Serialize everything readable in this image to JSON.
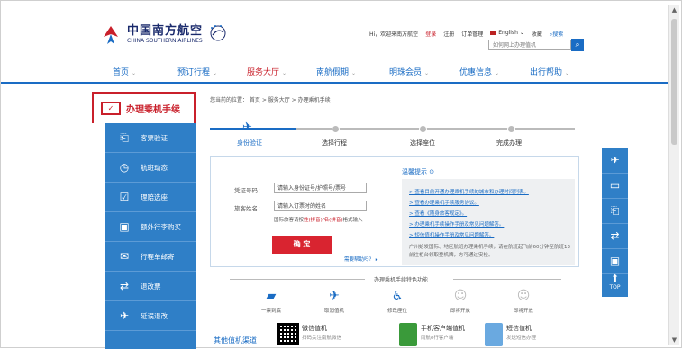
{
  "header": {
    "logo_cn": "中国南方航空",
    "logo_en": "CHINA SOUTHERN AIRLINES",
    "greeting": "Hi，欢迎来南方航空",
    "login": "登录",
    "register": "注册",
    "orders": "订单管理",
    "language": "English",
    "favorites": "收藏",
    "search_link": "搜索",
    "search_placeholder": "如何网上办理值机"
  },
  "nav": {
    "items": [
      {
        "label": "首页"
      },
      {
        "label": "预订行程"
      },
      {
        "label": "服务大厅"
      },
      {
        "label": "南航假期"
      },
      {
        "label": "明珠会员"
      },
      {
        "label": "优惠信息"
      },
      {
        "label": "出行帮助"
      }
    ],
    "active_index": 2
  },
  "sidebar": {
    "title": "办理乘机手续",
    "items": [
      {
        "label": "客票验证",
        "icon": "ticket-icon"
      },
      {
        "label": "航班动态",
        "icon": "clock-icon"
      },
      {
        "label": "理赔选座",
        "icon": "seat-icon"
      },
      {
        "label": "额外行李购买",
        "icon": "luggage-icon"
      },
      {
        "label": "行程单邮寄",
        "icon": "mail-icon"
      },
      {
        "label": "退改票",
        "icon": "refund-icon"
      },
      {
        "label": "延误退改",
        "icon": "delay-icon"
      }
    ]
  },
  "breadcrumb": "您当前的位置： 首页 > 服务大厅 > 办理乘机手续",
  "steps": [
    {
      "label": "身份验证",
      "active": true
    },
    {
      "label": "选择行程",
      "active": false
    },
    {
      "label": "选择座位",
      "active": false
    },
    {
      "label": "完成办理",
      "active": false
    }
  ],
  "form": {
    "id_label": "凭证号码：",
    "id_placeholder": "请输入身份证号/护照号/票号",
    "name_label": "旅客姓名：",
    "name_placeholder": "请输入订票时的姓名",
    "hint_prefix": "国际旅客请按",
    "hint_red1": "姓(拼音)",
    "hint_slash": "/",
    "hint_red2": "名(拼音)",
    "hint_suffix": "格式输入",
    "confirm": "确 定",
    "help": "需要帮助吗？ ▸"
  },
  "tips": {
    "title": "温馨提示",
    "items": [
      "> 查看目前开通办理乘机手续的城市和办理时间列表。",
      "> 查看办理乘机手续服务协议。",
      "> 查看《随身旅客规定》。",
      "> 办理乘机手续操作手册及常见问题解答。",
      "> 短信值机操作手册及常见问题解答。"
    ],
    "note": "广州始发国际、地区航班办理乘机手续，请在航班起飞前60分钟至航班13前往柜台领取登机牌，方可通过安检。"
  },
  "features": {
    "title": "办理乘机手续特色功能",
    "items": [
      {
        "label": "一票到底",
        "icon": "ticket-through-icon",
        "enabled": true
      },
      {
        "label": "取消值机",
        "icon": "cancel-checkin-icon",
        "enabled": true
      },
      {
        "label": "修改座位",
        "icon": "change-seat-icon",
        "enabled": true
      },
      {
        "label": "即将开放",
        "icon": "coming-soon-icon",
        "enabled": false
      },
      {
        "label": "即将开放",
        "icon": "coming-soon-icon",
        "enabled": false
      }
    ]
  },
  "bottom": {
    "section": "其他值机渠道",
    "wechat": "微信值机",
    "wechat_sub": "扫码关注南航微信",
    "app": "手机客户端值机",
    "app_sub": "南航e行客户端",
    "sms": "短信值机",
    "sms_sub": "发送短信办理"
  },
  "float": {
    "top_label": "TOP"
  }
}
